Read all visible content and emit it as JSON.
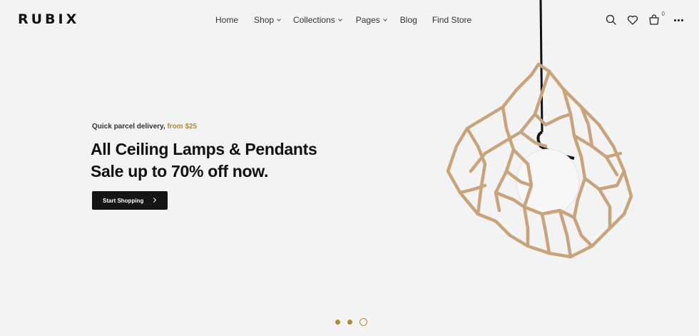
{
  "brand": {
    "name": "RUBIX"
  },
  "nav": {
    "home": "Home",
    "shop": "Shop",
    "collections": "Collections",
    "pages": "Pages",
    "blog": "Blog",
    "find_store": "Find Store"
  },
  "header_icons": {
    "search": "search-icon",
    "wishlist": "heart-icon",
    "cart": "bag-icon",
    "cart_count": "0",
    "more": "more-dots-icon"
  },
  "hero": {
    "eyebrow_prefix": "Quick parcel delivery,",
    "eyebrow_accent": "from $25",
    "headline_line1": "All Ceiling Lamps & Pendants",
    "headline_line2": "Sale up to 70% off now.",
    "cta_label": "Start Shopping"
  },
  "slider": {
    "slide_count": 3,
    "active_index": 3
  },
  "colors": {
    "accent": "#b38a3a",
    "background": "#f3f3f3",
    "button": "#151515"
  }
}
